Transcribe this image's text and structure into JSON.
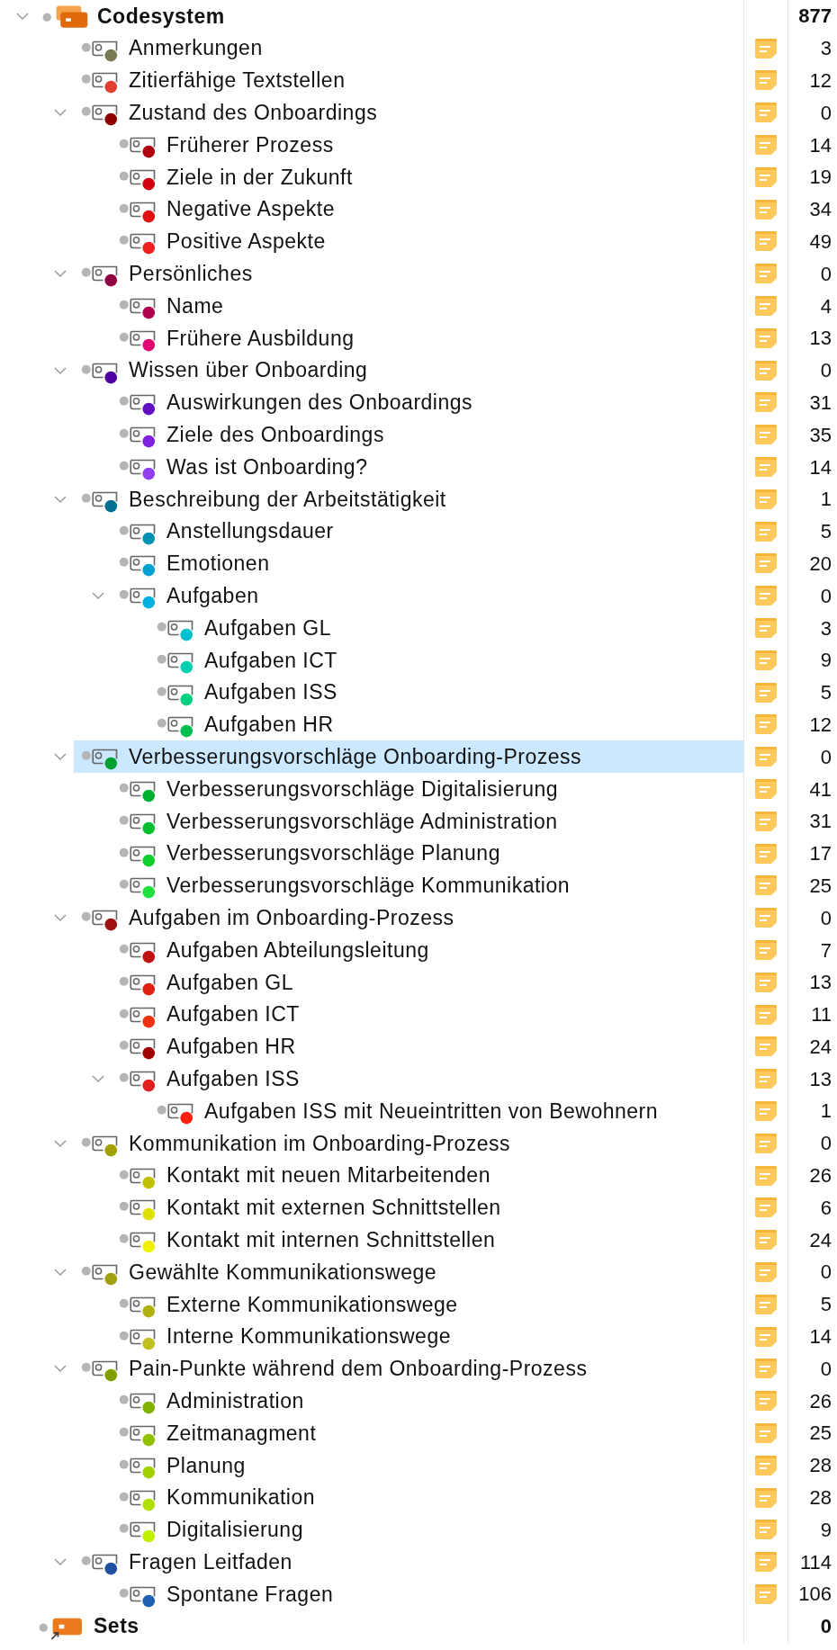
{
  "tree": [
    {
      "kind": "root",
      "label": "Codesystem",
      "count": "877",
      "expanded": true,
      "selected": false,
      "children": [
        {
          "kind": "code",
          "label": "Anmerkungen",
          "color": "#7a7a50",
          "memo": true,
          "count": "3",
          "selected": false
        },
        {
          "kind": "code",
          "label": "Zitierfähige Textstellen",
          "color": "#e04030",
          "memo": true,
          "count": "12",
          "selected": false
        },
        {
          "kind": "code",
          "label": "Zustand des Onboardings",
          "color": "#900000",
          "memo": true,
          "count": "0",
          "expanded": true,
          "selected": false,
          "children": [
            {
              "kind": "code",
              "label": "Früherer Prozess",
              "color": "#b00010",
              "memo": true,
              "count": "14",
              "selected": false
            },
            {
              "kind": "code",
              "label": "Ziele in der Zukunft",
              "color": "#d00010",
              "memo": true,
              "count": "19",
              "selected": false
            },
            {
              "kind": "code",
              "label": "Negative Aspekte",
              "color": "#e01010",
              "memo": true,
              "count": "34",
              "selected": false
            },
            {
              "kind": "code",
              "label": "Positive Aspekte",
              "color": "#f02020",
              "memo": true,
              "count": "49",
              "selected": false
            }
          ]
        },
        {
          "kind": "code",
          "label": "Persönliches",
          "color": "#900040",
          "memo": true,
          "count": "0",
          "expanded": true,
          "selected": false,
          "children": [
            {
              "kind": "code",
              "label": "Name",
              "color": "#b00050",
              "memo": true,
              "count": "4",
              "selected": false
            },
            {
              "kind": "code",
              "label": "Frühere Ausbildung",
              "color": "#e00070",
              "memo": true,
              "count": "13",
              "selected": false
            }
          ]
        },
        {
          "kind": "code",
          "label": "Wissen über Onboarding",
          "color": "#5000a0",
          "memo": true,
          "count": "0",
          "expanded": true,
          "selected": false,
          "children": [
            {
              "kind": "code",
              "label": "Auswirkungen des Onboardings",
              "color": "#6010c0",
              "memo": true,
              "count": "31",
              "selected": false
            },
            {
              "kind": "code",
              "label": "Ziele des Onboardings",
              "color": "#8020e0",
              "memo": true,
              "count": "35",
              "selected": false
            },
            {
              "kind": "code",
              "label": "Was ist Onboarding?",
              "color": "#9040f0",
              "memo": true,
              "count": "14",
              "selected": false
            }
          ]
        },
        {
          "kind": "code",
          "label": "Beschreibung der Arbeitstätigkeit",
          "color": "#007090",
          "memo": true,
          "count": "1",
          "expanded": true,
          "selected": false,
          "children": [
            {
              "kind": "code",
              "label": "Anstellungsdauer",
              "color": "#0090b0",
              "memo": true,
              "count": "5",
              "selected": false
            },
            {
              "kind": "code",
              "label": "Emotionen",
              "color": "#00a0d0",
              "memo": true,
              "count": "20",
              "selected": false
            },
            {
              "kind": "code",
              "label": "Aufgaben",
              "color": "#00b0e0",
              "memo": true,
              "count": "0",
              "expanded": true,
              "selected": false,
              "children": [
                {
                  "kind": "code",
                  "label": "Aufgaben GL",
                  "color": "#00c0d0",
                  "memo": true,
                  "count": "3",
                  "selected": false
                },
                {
                  "kind": "code",
                  "label": "Aufgaben ICT",
                  "color": "#00d0b0",
                  "memo": true,
                  "count": "9",
                  "selected": false
                },
                {
                  "kind": "code",
                  "label": "Aufgaben ISS",
                  "color": "#00d080",
                  "memo": true,
                  "count": "5",
                  "selected": false
                },
                {
                  "kind": "code",
                  "label": "Aufgaben HR",
                  "color": "#00c050",
                  "memo": true,
                  "count": "12",
                  "selected": false
                }
              ]
            }
          ]
        },
        {
          "kind": "code",
          "label": "Verbesserungsvorschläge Onboarding-Prozess",
          "color": "#00a030",
          "memo": true,
          "count": "0",
          "expanded": true,
          "selected": true,
          "children": [
            {
              "kind": "code",
              "label": "Verbesserungsvorschläge Digitalisierung",
              "color": "#00b030",
              "memo": true,
              "count": "41",
              "selected": false
            },
            {
              "kind": "code",
              "label": "Verbesserungsvorschläge Administration",
              "color": "#00c030",
              "memo": true,
              "count": "31",
              "selected": false
            },
            {
              "kind": "code",
              "label": "Verbesserungsvorschläge Planung",
              "color": "#10d030",
              "memo": true,
              "count": "17",
              "selected": false
            },
            {
              "kind": "code",
              "label": "Verbesserungsvorschläge Kommunikation",
              "color": "#20e040",
              "memo": true,
              "count": "25",
              "selected": false
            }
          ]
        },
        {
          "kind": "code",
          "label": "Aufgaben im Onboarding-Prozess",
          "color": "#a01010",
          "memo": true,
          "count": "0",
          "expanded": true,
          "selected": false,
          "children": [
            {
              "kind": "code",
              "label": "Aufgaben Abteilungsleitung",
              "color": "#c01010",
              "memo": true,
              "count": "7",
              "selected": false
            },
            {
              "kind": "code",
              "label": "Aufgaben GL",
              "color": "#e02010",
              "memo": true,
              "count": "13",
              "selected": false
            },
            {
              "kind": "code",
              "label": "Aufgaben ICT",
              "color": "#f03010",
              "memo": true,
              "count": "11",
              "selected": false
            },
            {
              "kind": "code",
              "label": "Aufgaben HR",
              "color": "#a00000",
              "memo": true,
              "count": "24",
              "selected": false
            },
            {
              "kind": "code",
              "label": "Aufgaben ISS",
              "color": "#e02020",
              "memo": true,
              "count": "13",
              "expanded": true,
              "selected": false,
              "children": [
                {
                  "kind": "code",
                  "label": "Aufgaben ISS mit Neueintritten von Bewohnern",
                  "color": "#ff2010",
                  "memo": true,
                  "count": "1",
                  "selected": false
                }
              ]
            }
          ]
        },
        {
          "kind": "code",
          "label": "Kommunikation im Onboarding-Prozess",
          "color": "#a0a000",
          "memo": true,
          "count": "0",
          "expanded": true,
          "selected": false,
          "children": [
            {
              "kind": "code",
              "label": "Kontakt mit neuen Mitarbeitenden",
              "color": "#c0c000",
              "memo": true,
              "count": "26",
              "selected": false
            },
            {
              "kind": "code",
              "label": "Kontakt mit externen Schnittstellen",
              "color": "#e0e000",
              "memo": true,
              "count": "6",
              "selected": false
            },
            {
              "kind": "code",
              "label": "Kontakt mit internen Schnittstellen",
              "color": "#f0f000",
              "memo": true,
              "count": "24",
              "selected": false
            }
          ]
        },
        {
          "kind": "code",
          "label": "Gewählte Kommunikationswege",
          "color": "#a0a010",
          "memo": true,
          "count": "0",
          "expanded": true,
          "selected": false,
          "children": [
            {
              "kind": "code",
              "label": "Externe Kommunikationswege",
              "color": "#b0b010",
              "memo": true,
              "count": "5",
              "selected": false
            },
            {
              "kind": "code",
              "label": "Interne Kommunikationswege",
              "color": "#c0c020",
              "memo": true,
              "count": "14",
              "selected": false
            }
          ]
        },
        {
          "kind": "code",
          "label": "Pain-Punkte während dem Onboarding-Prozess",
          "color": "#80a000",
          "memo": true,
          "count": "0",
          "expanded": true,
          "selected": false,
          "children": [
            {
              "kind": "code",
              "label": "Administration",
              "color": "#80b000",
              "memo": true,
              "count": "26",
              "selected": false
            },
            {
              "kind": "code",
              "label": "Zeitmanagment",
              "color": "#90c000",
              "memo": true,
              "count": "25",
              "selected": false
            },
            {
              "kind": "code",
              "label": "Planung",
              "color": "#a0d000",
              "memo": true,
              "count": "28",
              "selected": false
            },
            {
              "kind": "code",
              "label": "Kommunikation",
              "color": "#b0e000",
              "memo": true,
              "count": "28",
              "selected": false
            },
            {
              "kind": "code",
              "label": "Digitalisierung",
              "color": "#c0f000",
              "memo": true,
              "count": "9",
              "selected": false
            }
          ]
        },
        {
          "kind": "code",
          "label": "Fragen Leitfaden",
          "color": "#2050a0",
          "memo": true,
          "count": "114",
          "expanded": true,
          "selected": false,
          "children": [
            {
              "kind": "code",
              "label": "Spontane Fragen",
              "color": "#2060b0",
              "memo": true,
              "count": "106",
              "selected": false
            }
          ]
        }
      ]
    },
    {
      "kind": "set",
      "label": "Sets",
      "count": "0",
      "selected": false
    }
  ]
}
